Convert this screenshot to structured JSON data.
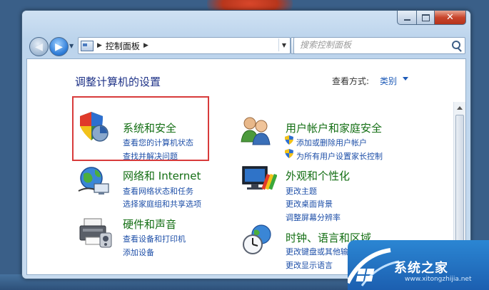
{
  "window": {
    "caption_min": "",
    "caption_max": "",
    "caption_close": "✕"
  },
  "nav": {
    "back_glyph": "◀",
    "forward_glyph": "▶",
    "dropdown_glyph": "▼"
  },
  "address": {
    "separator": "▶",
    "crumb": "控制面板",
    "trailing_separator": "▶",
    "dropdown_glyph": "▼"
  },
  "refresh_glyph": "⇅",
  "search": {
    "placeholder": "搜索控制面板"
  },
  "content": {
    "title": "调整计算机的设置",
    "view_by_label": "查看方式:",
    "view_by_value": "类别"
  },
  "categories": [
    {
      "heading": "系统和安全",
      "links": [
        "查看您的计算机状态",
        "查找并解决问题"
      ],
      "icon": "security-shield-icon"
    },
    {
      "heading": "网络和 Internet",
      "links": [
        "查看网络状态和任务",
        "选择家庭组和共享选项"
      ],
      "icon": "network-globe-icon"
    },
    {
      "heading": "硬件和声音",
      "links": [
        "查看设备和打印机",
        "添加设备"
      ],
      "icon": "printer-icon"
    },
    {
      "heading": "用户帐户和家庭安全",
      "links": [
        "添加或删除用户帐户",
        "为所有用户设置家长控制"
      ],
      "icon": "users-icon"
    },
    {
      "heading": "外观和个性化",
      "links": [
        "更改主题",
        "更改桌面背景",
        "调整屏幕分辨率"
      ],
      "icon": "monitor-palette-icon"
    },
    {
      "heading": "时钟、语言和区域",
      "links": [
        "更改键盘或其他输入法",
        "更改显示语言"
      ],
      "icon": "clock-globe-icon"
    }
  ],
  "watermark": {
    "title": "系统之家",
    "url": "www.xitongzhijia.net"
  },
  "colors": {
    "heading_green": "#136e13",
    "link_blue": "#1e4fa8",
    "title_blue": "#1e3287",
    "highlight_red": "#d83b3b"
  }
}
